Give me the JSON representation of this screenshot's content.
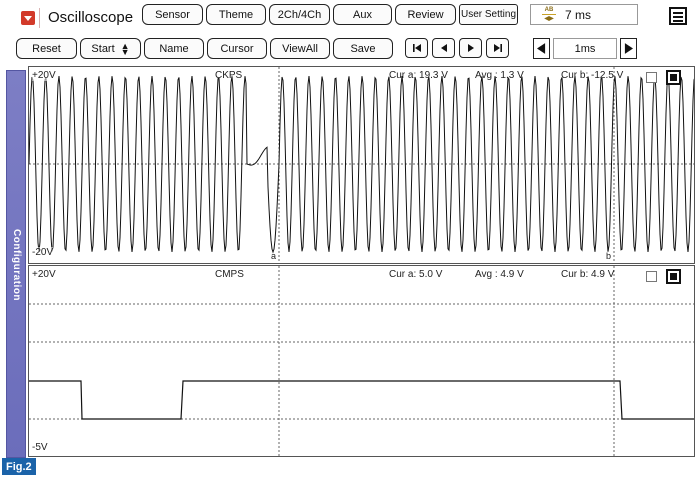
{
  "app": {
    "title": "Oscilloscope"
  },
  "toolbar": {
    "tabs": [
      "Sensor",
      "Theme",
      "2Ch/4Ch",
      "Aux",
      "Review",
      "User Setting"
    ],
    "time_per_div": "7 ms",
    "icons": {
      "app": "app-menu-icon",
      "time": "ab-time-icon",
      "menu": "menu-icon"
    }
  },
  "controls": {
    "buttons": [
      "Reset",
      "Start",
      "Name",
      "Cursor",
      "ViewAll",
      "Save"
    ],
    "start_dropdown_icon": "up-down-arrows-icon",
    "nav": [
      "first",
      "prev",
      "next",
      "last"
    ],
    "time_base": "1ms"
  },
  "sidebar": {
    "label": "Configuration"
  },
  "channels": [
    {
      "name": "CKPS",
      "vmax": "+20V",
      "vmin": "-20V",
      "cur_a": "Cur a: 19.3 V",
      "avg": "Avg : 1.3 V",
      "cur_b": "Cur b: -12.5 V",
      "cursor_a_label": "a",
      "cursor_b_label": "b"
    },
    {
      "name": "CMPS",
      "vmax": "+20V",
      "vmin": "-5V",
      "cur_a": "Cur a: 5.0 V",
      "avg": "Avg : 4.9 V",
      "cur_b": "Cur b: 4.9 V"
    }
  ],
  "figure_label": "Fig.2",
  "colors": {
    "sidebar": "#6b6dbb",
    "app_icon": "#d23a2a",
    "fig_label": "#1b63a9",
    "trace": "#111111"
  }
}
